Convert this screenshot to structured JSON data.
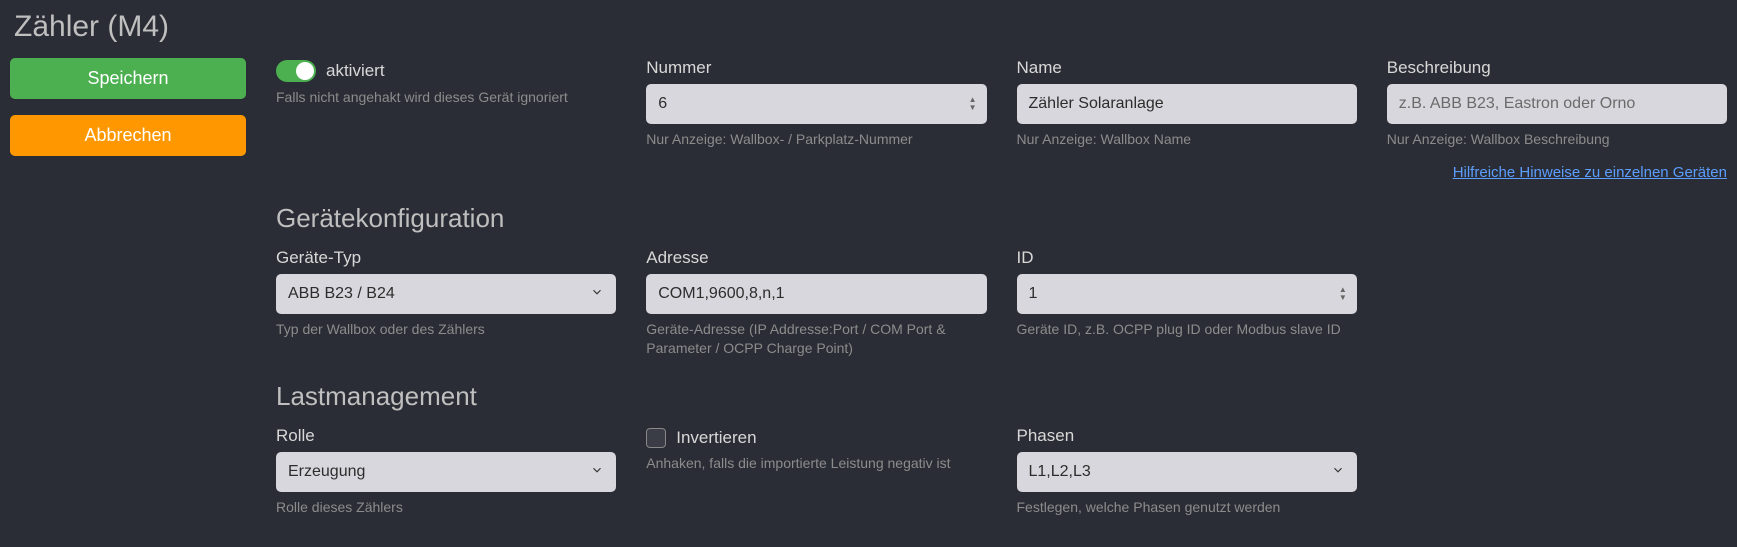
{
  "title_main": "Zähler",
  "title_sub": "(M4)",
  "sidebar": {
    "save": "Speichern",
    "cancel": "Abbrechen"
  },
  "activated": {
    "label": "aktiviert",
    "help": "Falls nicht angehakt wird dieses Gerät ignoriert"
  },
  "number": {
    "label": "Nummer",
    "value": "6",
    "help": "Nur Anzeige: Wallbox- / Parkplatz-Nummer"
  },
  "name": {
    "label": "Name",
    "value": "Zähler Solaranlage",
    "help": "Nur Anzeige: Wallbox Name"
  },
  "description": {
    "label": "Beschreibung",
    "placeholder": "z.B. ABB B23, Eastron oder Orno",
    "help": "Nur Anzeige: Wallbox Beschreibung"
  },
  "hint_link": "Hilfreiche Hinweise zu einzelnen Geräten",
  "section_device": "Gerätekonfiguration",
  "device_type": {
    "label": "Geräte-Typ",
    "value": "ABB B23 / B24",
    "help": "Typ der Wallbox oder des Zählers"
  },
  "address": {
    "label": "Adresse",
    "value": "COM1,9600,8,n,1",
    "help": "Geräte-Adresse (IP Addresse:Port / COM Port & Parameter / OCPP Charge Point)"
  },
  "id": {
    "label": "ID",
    "value": "1",
    "help": "Geräte ID, z.B. OCPP plug ID oder Modbus slave ID"
  },
  "section_load": "Lastmanagement",
  "role": {
    "label": "Rolle",
    "value": "Erzeugung",
    "help": "Rolle dieses Zählers"
  },
  "invert": {
    "label": "Invertieren",
    "help": "Anhaken, falls die importierte Leistung negativ ist"
  },
  "phases": {
    "label": "Phasen",
    "value": "L1,L2,L3",
    "help": "Festlegen, welche Phasen genutzt werden"
  }
}
